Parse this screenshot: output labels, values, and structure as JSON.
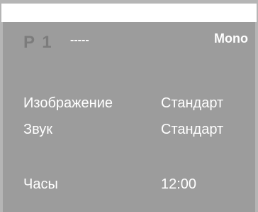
{
  "header": {
    "channel": "P 1",
    "channel_name": "-----",
    "sound_mode": "Mono"
  },
  "menu": {
    "items": [
      {
        "label": "Изображение",
        "value": "Стандарт"
      },
      {
        "label": "Звук",
        "value": "Стандарт"
      },
      {
        "label": "Часы",
        "value": "12:00"
      }
    ]
  },
  "colors": {
    "osd_background": "#9c9c9c",
    "frame": "#b5b5b5",
    "channel_text": "#7c7c7c",
    "text": "#ffffff"
  }
}
